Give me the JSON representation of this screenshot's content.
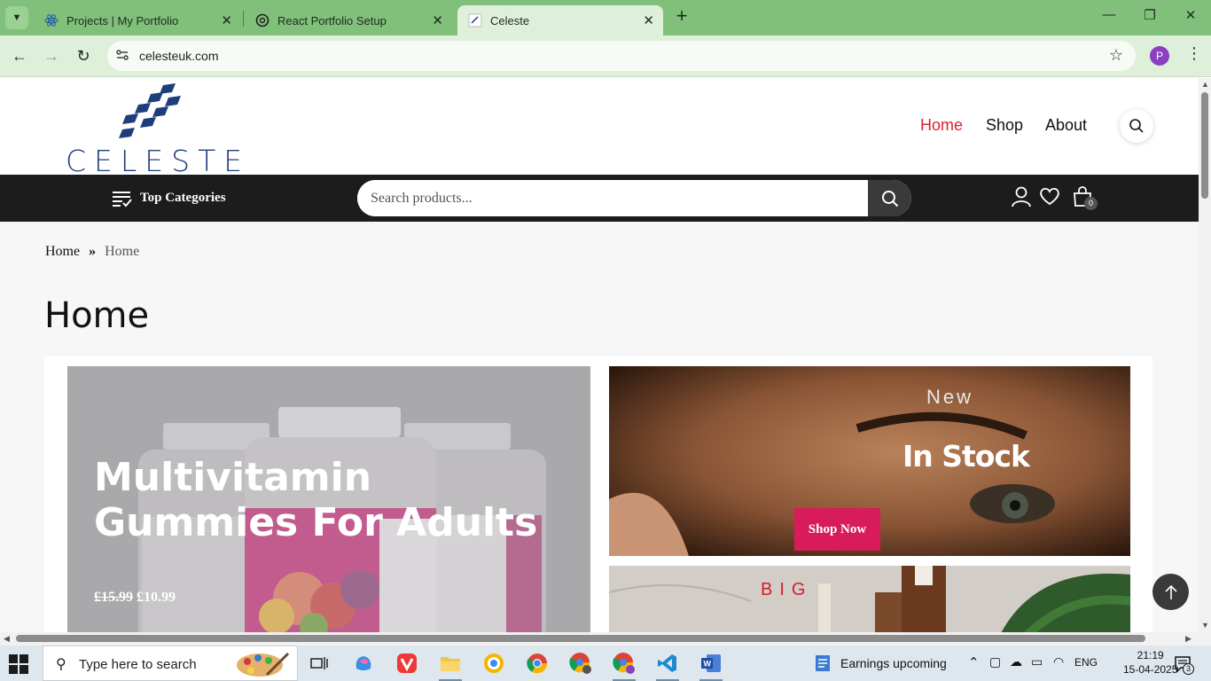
{
  "browser": {
    "tabs": [
      {
        "title": "Projects | My Portfolio",
        "icon": "react-icon"
      },
      {
        "title": "React Portfolio Setup",
        "icon": "chatgpt-icon"
      },
      {
        "title": "Celeste",
        "icon": "celeste-favicon"
      }
    ],
    "active_tab": 2,
    "url": "celesteuk.com",
    "profile_initial": "P"
  },
  "site": {
    "logo_text": "CELESTE",
    "nav": [
      "Home",
      "Shop",
      "About"
    ],
    "active_nav": "Home",
    "category_label": "Top Categories",
    "search_placeholder": "Search products...",
    "cart_count": "0"
  },
  "page": {
    "breadcrumb": [
      "Home",
      "Home"
    ],
    "title": "Home"
  },
  "banners": {
    "left": {
      "title": "Multivitamin Gummies For Adults",
      "old_price": "£15.99",
      "new_price": "£10.99"
    },
    "right_top": {
      "eyebrow": "New",
      "headline": "In Stock",
      "button": "Shop Now"
    },
    "right_bottom": {
      "eyebrow": "BIG"
    }
  },
  "taskbar": {
    "search_placeholder": "Type here to search",
    "news": "Earnings upcoming",
    "language": "ENG",
    "time": "21:19",
    "date": "15-04-2025",
    "notifications": "3"
  },
  "colors": {
    "accent_red": "#e0202d",
    "button_pink": "#d81b5a",
    "dark_bar": "#1c1c1c",
    "chrome_green": "#80c07a"
  }
}
